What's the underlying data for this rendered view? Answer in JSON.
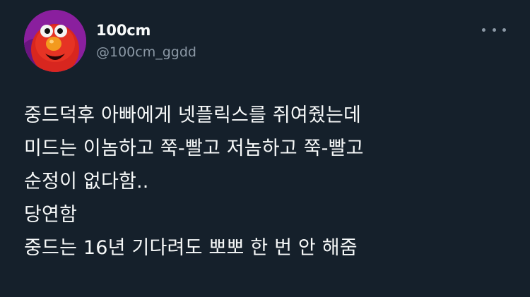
{
  "tweet": {
    "author": {
      "display_name": "100cm",
      "handle": "@100cm_ggdd",
      "avatar": "elmo-avatar"
    },
    "more_icon": "more-horizontal-icon",
    "text_lines": [
      "중드덕후 아빠에게 넷플릭스를 쥐여줬는데",
      "미드는 이놈하고 쭉-빨고 저놈하고 쭉-빨고",
      "순정이 없다함..",
      "당연함",
      "중드는 16년 기다려도 뽀뽀 한 번 안 해줌"
    ]
  },
  "colors": {
    "background": "#15202b",
    "primary_text": "#f7f9f9",
    "secondary_text": "#8b98a5"
  }
}
